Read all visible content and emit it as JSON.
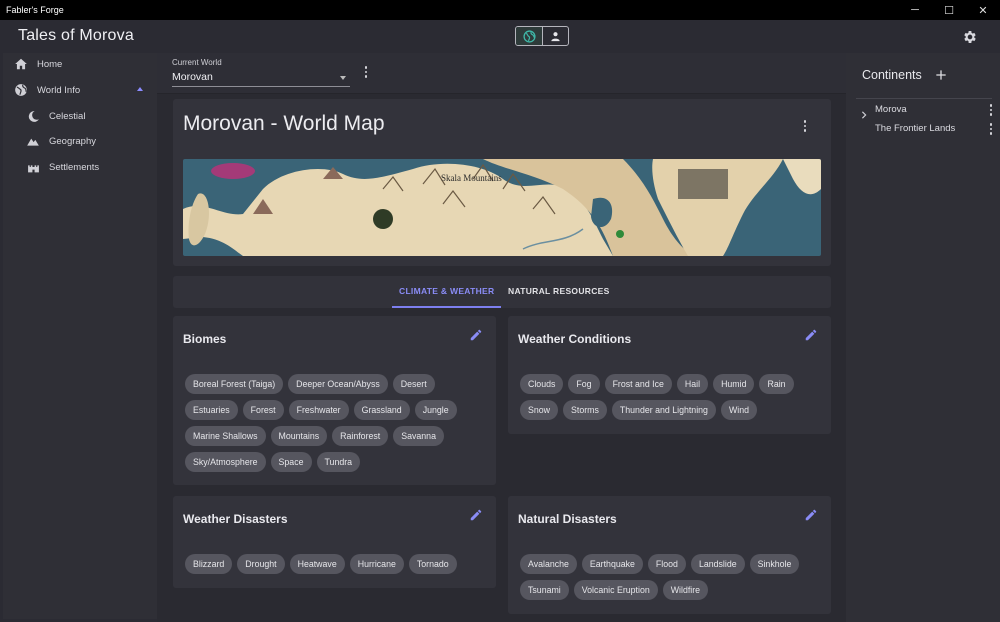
{
  "window": {
    "title": "Fabler's Forge",
    "minimize": "─",
    "maximize": "☐",
    "close": "✕"
  },
  "app": {
    "title": "Tales of Morova"
  },
  "nav": {
    "items": [
      {
        "label": "Home"
      },
      {
        "label": "World Info"
      },
      {
        "label": "Celestial"
      },
      {
        "label": "Geography"
      },
      {
        "label": "Settlements"
      }
    ]
  },
  "world_select": {
    "label": "Current World",
    "value": "Morovan"
  },
  "map": {
    "title": "Morovan - World Map",
    "label": "Skala Mountains"
  },
  "tabs": [
    {
      "label": "CLIMATE & WEATHER",
      "active": true
    },
    {
      "label": "NATURAL RESOURCES",
      "active": false
    }
  ],
  "cards": {
    "biomes": {
      "title": "Biomes",
      "chips": [
        "Boreal Forest (Taiga)",
        "Deeper Ocean/Abyss",
        "Desert",
        "Estuaries",
        "Forest",
        "Freshwater",
        "Grassland",
        "Jungle",
        "Marine Shallows",
        "Mountains",
        "Rainforest",
        "Savanna",
        "Sky/Atmosphere",
        "Space",
        "Tundra"
      ]
    },
    "weather_conditions": {
      "title": "Weather Conditions",
      "chips": [
        "Clouds",
        "Fog",
        "Frost and Ice",
        "Hail",
        "Humid",
        "Rain",
        "Snow",
        "Storms",
        "Thunder and Lightning",
        "Wind"
      ]
    },
    "weather_disasters": {
      "title": "Weather Disasters",
      "chips": [
        "Blizzard",
        "Drought",
        "Heatwave",
        "Hurricane",
        "Tornado"
      ]
    },
    "natural_disasters": {
      "title": "Natural Disasters",
      "chips": [
        "Avalanche",
        "Earthquake",
        "Flood",
        "Landslide",
        "Sinkhole",
        "Tsunami",
        "Volcanic Eruption",
        "Wildfire"
      ]
    }
  },
  "continents": {
    "title": "Continents",
    "items": [
      {
        "label": "Morova"
      },
      {
        "label": "The Frontier Lands"
      }
    ]
  },
  "colors": {
    "accent": "#8a8cf6",
    "chip": "#56565f",
    "card": "#33333b",
    "globe": "#3fb8a8"
  }
}
